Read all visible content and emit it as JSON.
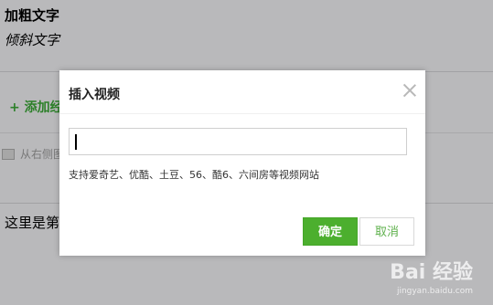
{
  "editor": {
    "bold_text": "加粗文字",
    "italic_text": "倾斜文字",
    "add_link": "+ 添加经",
    "image_hint": "从右侧图",
    "body_text": "这里是第"
  },
  "dialog": {
    "title": "插入视频",
    "input_value": "",
    "support_text": "支持爱奇艺、优酷、土豆、56、酷6、六间房等视频网站",
    "confirm_label": "确定",
    "cancel_label": "取消"
  },
  "watermark": {
    "logo": "Bai 经验",
    "url": "jingyan.baidu.com"
  },
  "colors": {
    "accent_green": "#4caf2e",
    "link_green": "#3aa536",
    "overlay": "rgba(0,0,0,0.22)"
  }
}
